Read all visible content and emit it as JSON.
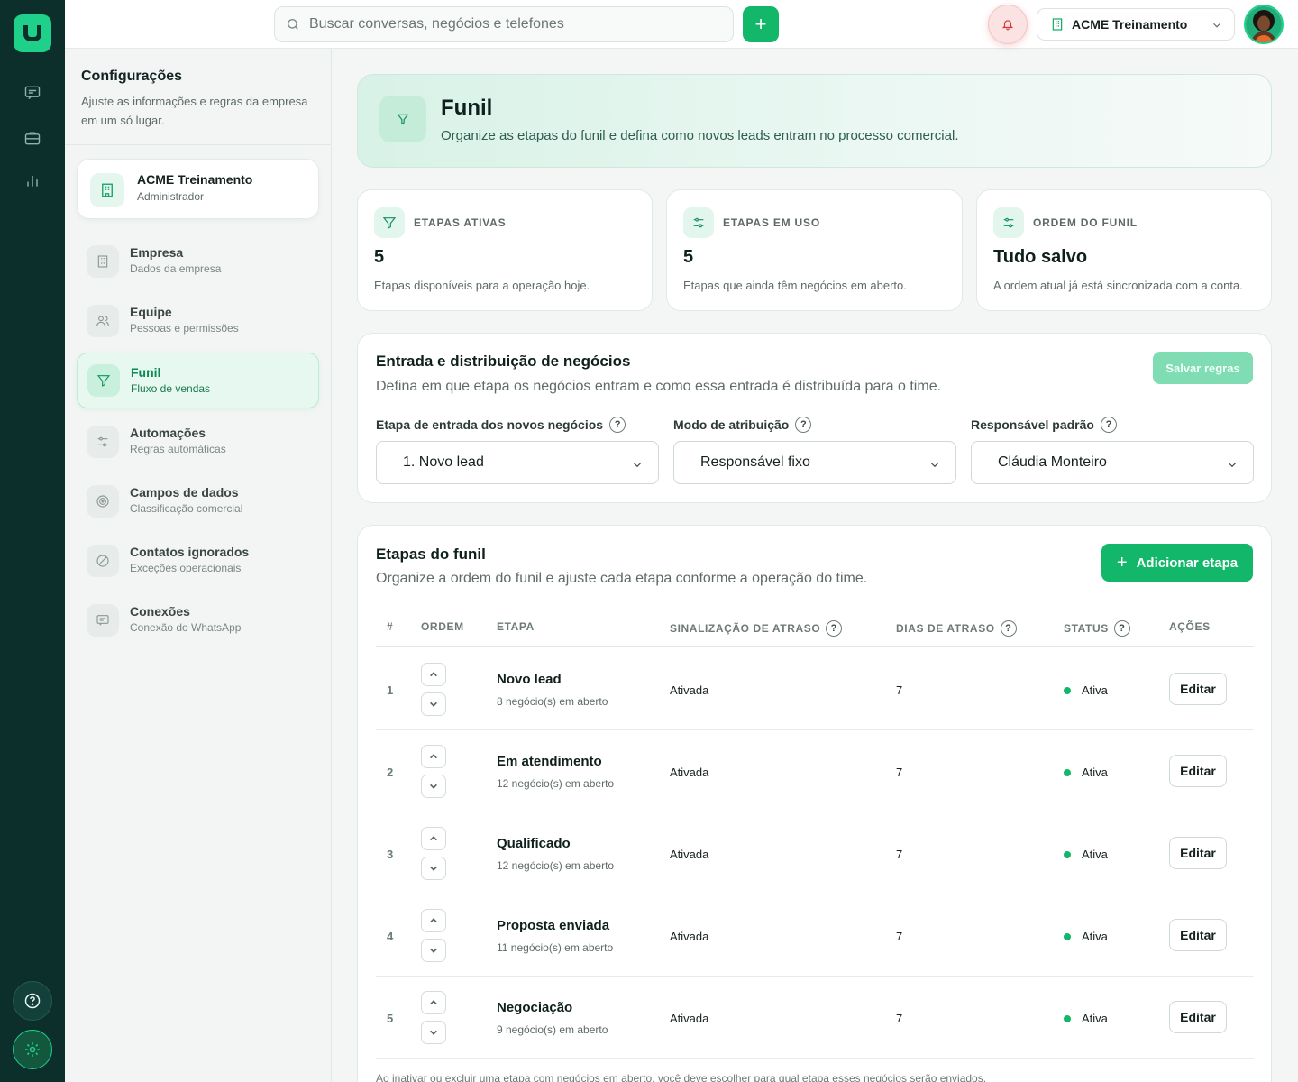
{
  "rail": {
    "icons": [
      "chat-icon",
      "briefcase-icon",
      "chart-icon",
      "help-icon",
      "settings-icon"
    ]
  },
  "topbar": {
    "search_placeholder": "Buscar conversas, negócios e telefones",
    "add_label": "+",
    "org_name": "ACME Treinamento"
  },
  "sidebar": {
    "title": "Configurações",
    "subtitle": "Ajuste as informações e regras da empresa em um só lugar.",
    "company": {
      "name": "ACME Treinamento",
      "role": "Administrador"
    },
    "items": [
      {
        "label": "Empresa",
        "sub": "Dados da empresa",
        "icon": "building-icon"
      },
      {
        "label": "Equipe",
        "sub": "Pessoas e permissões",
        "icon": "users-icon"
      },
      {
        "label": "Funil",
        "sub": "Fluxo de vendas",
        "icon": "funnel-icon",
        "active": true
      },
      {
        "label": "Automações",
        "sub": "Regras automáticas",
        "icon": "sliders-icon"
      },
      {
        "label": "Campos de dados",
        "sub": "Classificação comercial",
        "icon": "target-icon"
      },
      {
        "label": "Contatos ignorados",
        "sub": "Exceções operacionais",
        "icon": "blocked-icon"
      },
      {
        "label": "Conexões",
        "sub": "Conexão do WhatsApp",
        "icon": "message-icon"
      }
    ]
  },
  "hero": {
    "title": "Funil",
    "subtitle": "Organize as etapas do funil e defina como novos leads entram no processo comercial."
  },
  "stats": [
    {
      "label": "ETAPAS ATIVAS",
      "value": "5",
      "desc": "Etapas disponíveis para a operação hoje."
    },
    {
      "label": "ETAPAS EM USO",
      "value": "5",
      "desc": "Etapas que ainda têm negócios em aberto."
    },
    {
      "label": "ORDEM DO FUNIL",
      "value": "Tudo salvo",
      "desc": "A ordem atual já está sincronizada com a conta."
    }
  ],
  "rules": {
    "title": "Entrada e distribuição de negócios",
    "subtitle": "Defina em que etapa os negócios entram e como essa entrada é distribuída para o time.",
    "save_label": "Salvar regras",
    "fields": [
      {
        "label": "Etapa de entrada dos novos negócios",
        "value": "1. Novo lead"
      },
      {
        "label": "Modo de atribuição",
        "value": "Responsável fixo"
      },
      {
        "label": "Responsável padrão",
        "value": "Cláudia Monteiro"
      }
    ]
  },
  "stages": {
    "title": "Etapas do funil",
    "subtitle": "Organize a ordem do funil e ajuste cada etapa conforme a operação do time.",
    "add_label": "Adicionar etapa",
    "columns": [
      "#",
      "ORDEM",
      "ETAPA",
      "SINALIZAÇÃO DE ATRASO",
      "DIAS DE ATRASO",
      "STATUS",
      "AÇÕES"
    ],
    "rows": [
      {
        "num": "1",
        "name": "Novo lead",
        "open": "8 negócio(s) em aberto",
        "signal": "Ativada",
        "days": "7",
        "status": "Ativa",
        "action": "Editar"
      },
      {
        "num": "2",
        "name": "Em atendimento",
        "open": "12 negócio(s) em aberto",
        "signal": "Ativada",
        "days": "7",
        "status": "Ativa",
        "action": "Editar"
      },
      {
        "num": "3",
        "name": "Qualificado",
        "open": "12 negócio(s) em aberto",
        "signal": "Ativada",
        "days": "7",
        "status": "Ativa",
        "action": "Editar"
      },
      {
        "num": "4",
        "name": "Proposta enviada",
        "open": "11 negócio(s) em aberto",
        "signal": "Ativada",
        "days": "7",
        "status": "Ativa",
        "action": "Editar"
      },
      {
        "num": "5",
        "name": "Negociação",
        "open": "9 negócio(s) em aberto",
        "signal": "Ativada",
        "days": "7",
        "status": "Ativa",
        "action": "Editar"
      }
    ],
    "footnote": "Ao inativar ou excluir uma etapa com negócios em aberto, você deve escolher para qual etapa esses negócios serão enviados."
  },
  "colors": {
    "rail": "#0c2f2c",
    "brand": "#1fd08a",
    "primary": "#12b76a",
    "alert": "#fbe3e3"
  }
}
